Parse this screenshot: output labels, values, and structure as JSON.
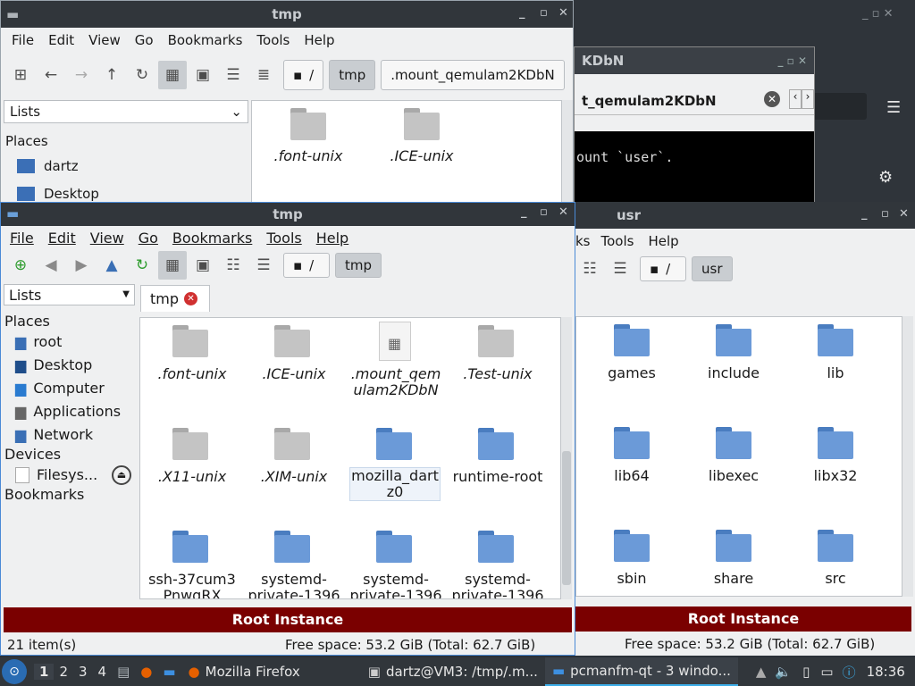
{
  "top_window": {
    "title": "tmp",
    "menu": [
      "File",
      "Edit",
      "View",
      "Go",
      "Bookmarks",
      "Tools",
      "Help"
    ],
    "path": [
      "/",
      "tmp",
      ".mount_qemulam2KDbN"
    ],
    "sidebar_select": "Lists",
    "places_heading": "Places",
    "places": [
      "dartz",
      "Desktop"
    ],
    "files": [
      ".font-unix",
      ".ICE-unix"
    ]
  },
  "terminal": {
    "title_partial": "KDbN",
    "tab_label": "t_qemulam2KDbN",
    "output": "ount `user`."
  },
  "main_window": {
    "title": "tmp",
    "menu": [
      "File",
      "Edit",
      "View",
      "Go",
      "Bookmarks",
      "Tools",
      "Help"
    ],
    "path": [
      "/",
      "tmp"
    ],
    "tab": "tmp",
    "sidebar_select": "Lists",
    "places_heading": "Places",
    "places": [
      "root",
      "Desktop",
      "Computer",
      "Applications",
      "Network"
    ],
    "devices_heading": "Devices",
    "devices": [
      "Filesys..."
    ],
    "bookmarks_heading": "Bookmarks",
    "files_row1": [
      ".font-unix",
      ".ICE-unix",
      ".mount_qem\nulam2KDbN",
      ".Test-unix"
    ],
    "files_row2": [
      ".X11-unix",
      ".XIM-unix",
      "mozilla_dart\nz0",
      "runtime-root"
    ],
    "files_row3": [
      "ssh-37cum3\nPnwgRX",
      "systemd-\nprivate-1396",
      "systemd-\nprivate-1396",
      "systemd-\nprivate-1396"
    ],
    "status_banner": "Root Instance",
    "item_count": "21 item(s)",
    "free_space": "Free space: 53.2 GiB (Total: 62.7 GiB)"
  },
  "usr_window": {
    "title": "usr",
    "menu_partial": [
      "ks",
      "Tools",
      "Help"
    ],
    "path": [
      "/",
      "usr"
    ],
    "files": [
      "games",
      "include",
      "lib",
      "lib64",
      "libexec",
      "libx32",
      "sbin",
      "share",
      "src"
    ],
    "status_banner": "Root Instance",
    "free_space": "Free space: 53.2 GiB (Total: 62.7 GiB)"
  },
  "taskbar": {
    "desktops": [
      "1",
      "2",
      "3",
      "4"
    ],
    "firefox": "Mozilla Firefox",
    "terminal": "dartz@VM3: /tmp/.m...",
    "filemanager": "pcmanfm-qt - 3 windo...",
    "clock": "18:36"
  }
}
